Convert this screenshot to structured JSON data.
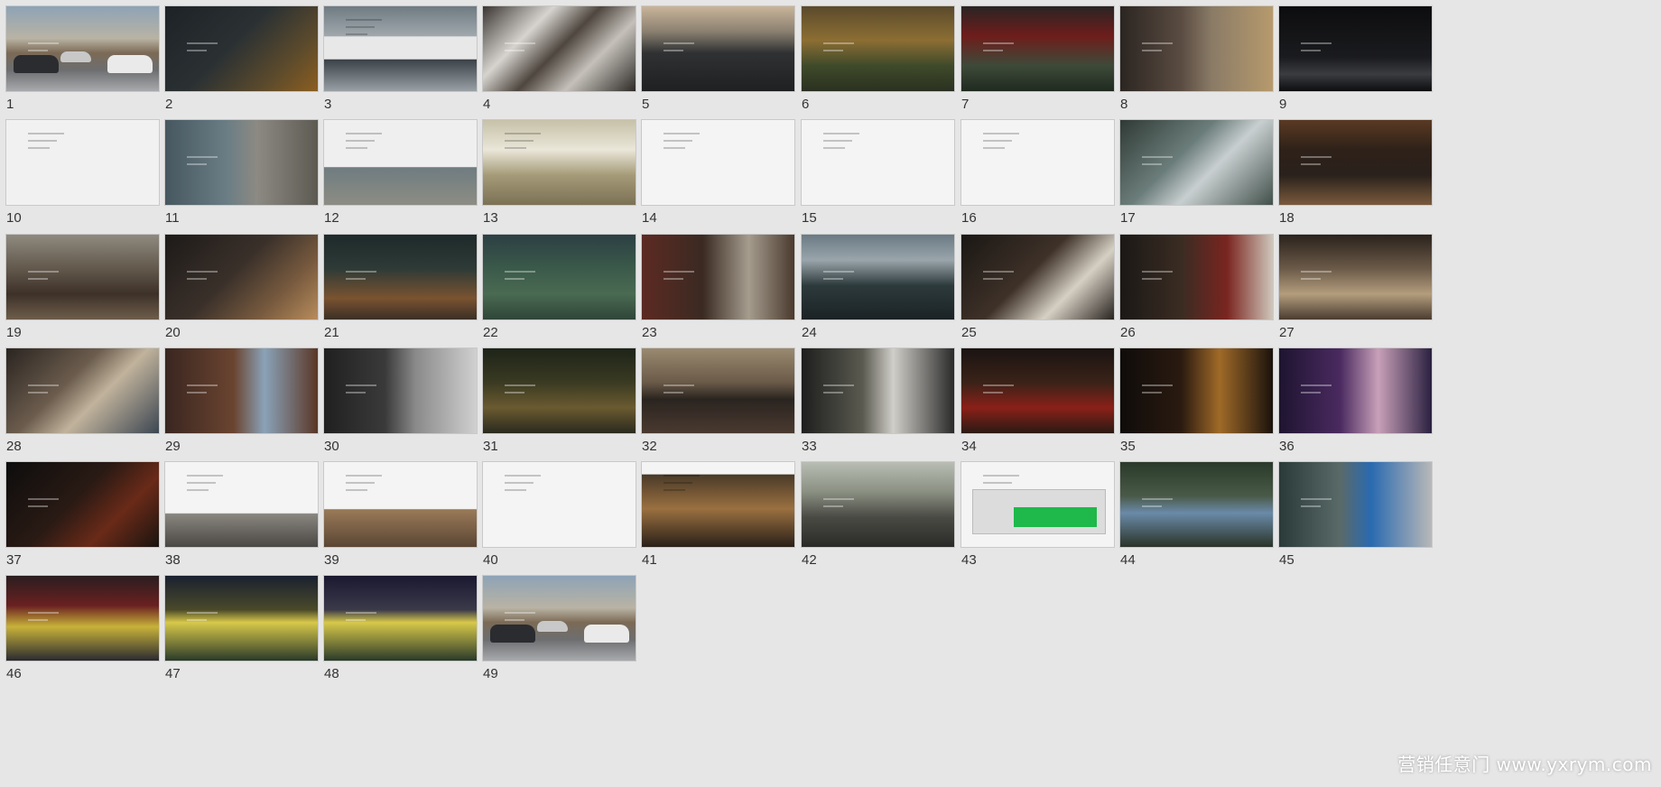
{
  "slides": [
    {
      "label": "1",
      "bg": "linear-gradient(180deg,#8ea3b6 0%,#b9b3a4 38%,#7b6a55 55%,#6d6e70 75%,#a8aaad 100%)",
      "kind": "car"
    },
    {
      "label": "2",
      "bg": "linear-gradient(135deg,#1d2226 0%,#2b3133 45%,#5b4a2c 75%,#8b5e20 100%)",
      "kind": "dark"
    },
    {
      "label": "3",
      "bg": "linear-gradient(180deg,#6f7b82 0%,#a0a8ad 35%,#e8e8e8 36%,#e8e8e8 62%,#3b4248 63%,#9aa1a6 100%)",
      "kind": "light"
    },
    {
      "label": "4",
      "bg": "linear-gradient(135deg,#3a3532 0%,#d7d4cf 30%,#4e463f 50%,#c5c1ba 70%,#2e2a27 100%)",
      "kind": "dark"
    },
    {
      "label": "5",
      "bg": "linear-gradient(180deg,#c9b59a 0%,#8a7f70 30%,#2f3133 55%,#1e2022 100%)",
      "kind": "dark"
    },
    {
      "label": "6",
      "bg": "linear-gradient(180deg,#5a4a2c 0%,#8c6e33 40%,#3f4a2a 70%,#2a3020 100%)",
      "kind": "dark"
    },
    {
      "label": "7",
      "bg": "linear-gradient(180deg,#2a2424 0%,#6e1d1b 35%,#3e4a39 70%,#1f2a1f 100%)",
      "kind": "dark"
    },
    {
      "label": "8",
      "bg": "linear-gradient(90deg,#2b2521 0%,#5a4c42 40%,#8a7b66 60%,#b79a6d 100%)",
      "kind": "dark"
    },
    {
      "label": "9",
      "bg": "linear-gradient(180deg,#0d0d0f 0%,#1a1b1e 60%,#3a3c40 80%,#0d0d0f 100%)",
      "kind": "dark"
    },
    {
      "label": "10",
      "bg": "#f1f1f1",
      "kind": "light"
    },
    {
      "label": "11",
      "bg": "linear-gradient(90deg,#46575f 0%,#6a7d84 40%,#8c8a83 60%,#5d5a52 100%)",
      "kind": "dark"
    },
    {
      "label": "12",
      "bg": "linear-gradient(180deg,#efefef 0%,#efefef 55%,#6f7c80 56%,#8d8d84 100%)",
      "kind": "light"
    },
    {
      "label": "13",
      "bg": "linear-gradient(180deg,#c6c1a7 0%,#eae6d9 35%,#a59b79 65%,#7b7154 100%)",
      "kind": "light"
    },
    {
      "label": "14",
      "bg": "#f4f4f4",
      "kind": "light"
    },
    {
      "label": "15",
      "bg": "#f4f4f4",
      "kind": "light"
    },
    {
      "label": "16",
      "bg": "#f4f4f4",
      "kind": "light"
    },
    {
      "label": "17",
      "bg": "linear-gradient(135deg,#2f3a35 0%,#6b7d7a 40%,#c8cfd0 60%,#41504a 100%)",
      "kind": "dark"
    },
    {
      "label": "18",
      "bg": "linear-gradient(180deg,#5a3a23 0%,#2e2119 35%,#2a211c 65%,#7a5a3c 100%)",
      "kind": "dark"
    },
    {
      "label": "19",
      "bg": "linear-gradient(180deg,#8f8a7f 0%,#5d5246 45%,#3d3128 70%,#6e5d4b 100%)",
      "kind": "dark"
    },
    {
      "label": "20",
      "bg": "linear-gradient(135deg,#1d1a18 0%,#3a302a 45%,#7a5c3f 75%,#b88c5c 100%)",
      "kind": "dark"
    },
    {
      "label": "21",
      "bg": "linear-gradient(180deg,#1e2a2a 0%,#2e3a36 40%,#7a5330 75%,#3a2f25 100%)",
      "kind": "dark"
    },
    {
      "label": "22",
      "bg": "linear-gradient(180deg,#2c3f44 0%,#3b5a4a 40%,#4a6a52 70%,#2f4538 100%)",
      "kind": "dark"
    },
    {
      "label": "23",
      "bg": "linear-gradient(90deg,#5c2a22 0%,#3a2a22 40%,#a59c8e 70%,#4a3a2e 100%)",
      "kind": "dark"
    },
    {
      "label": "24",
      "bg": "linear-gradient(180deg,#6a7a84 0%,#9aa5ab 30%,#2d3a3c 60%,#1b2224 100%)",
      "kind": "dark"
    },
    {
      "label": "25",
      "bg": "linear-gradient(135deg,#1a1714 0%,#3e3128 45%,#d6d0c4 70%,#2a2420 100%)",
      "kind": "dark"
    },
    {
      "label": "26",
      "bg": "linear-gradient(90deg,#1b1816 0%,#3a2c22 40%,#7a2520 70%,#cfc7bb 100%)",
      "kind": "dark"
    },
    {
      "label": "27",
      "bg": "linear-gradient(180deg,#2a221c 0%,#6b5a48 40%,#b39d7d 70%,#4a3c30 100%)",
      "kind": "dark"
    },
    {
      "label": "28",
      "bg": "linear-gradient(135deg,#2a2420 0%,#6b5c4d 40%,#c1b39c 60%,#3c4652 100%)",
      "kind": "dark"
    },
    {
      "label": "29",
      "bg": "linear-gradient(90deg,#3a2620 0%,#6a4430 45%,#8aa3b8 65%,#5a3626 100%)",
      "kind": "dark"
    },
    {
      "label": "30",
      "bg": "linear-gradient(90deg,#202020 0%,#3a3a3a 40%,#8a8a8a 60%,#d0d0d0 100%)",
      "kind": "dark"
    },
    {
      "label": "31",
      "bg": "linear-gradient(180deg,#1e2418 0%,#3a3a22 40%,#6a5a30 70%,#2a2a1e 100%)",
      "kind": "dark"
    },
    {
      "label": "32",
      "bg": "linear-gradient(180deg,#9a8a70 0%,#6a5a48 40%,#2a2420 60%,#4a3a30 100%)",
      "kind": "dark"
    },
    {
      "label": "33",
      "bg": "linear-gradient(90deg,#1e1e1e 0%,#5a5a50 40%,#d0cec8 60%,#2a2a2a 100%)",
      "kind": "dark"
    },
    {
      "label": "34",
      "bg": "linear-gradient(180deg,#1a1412 0%,#3a2218 40%,#8a2018 70%,#2a1a14 100%)",
      "kind": "dark"
    },
    {
      "label": "35",
      "bg": "linear-gradient(90deg,#0f0c0a 0%,#2a1a10 40%,#a06a28 65%,#1a120c 100%)",
      "kind": "dark"
    },
    {
      "label": "36",
      "bg": "linear-gradient(90deg,#1e1430 0%,#4a2a60 40%,#c8a0b8 65%,#2a2040 100%)",
      "kind": "dark"
    },
    {
      "label": "37",
      "bg": "linear-gradient(135deg,#0d0d0d 0%,#2a1a14 45%,#6a2a18 70%,#1a1410 100%)",
      "kind": "dark"
    },
    {
      "label": "38",
      "bg": "linear-gradient(180deg,#f4f4f4 0%,#f4f4f4 60%,#8a8680 61%,#4a4844 100%)",
      "kind": "light"
    },
    {
      "label": "39",
      "bg": "linear-gradient(180deg,#f4f4f4 0%,#f4f4f4 55%,#9a7a58 56%,#5a4634 100%)",
      "kind": "light"
    },
    {
      "label": "40",
      "bg": "#f4f4f4",
      "kind": "light"
    },
    {
      "label": "41",
      "bg": "linear-gradient(180deg,#f4f4f4 0%,#f4f4f4 14%,#4a3a28 15%,#9a7040 55%,#2a2018 100%)",
      "kind": "light"
    },
    {
      "label": "42",
      "bg": "linear-gradient(180deg,#b9bdb4 0%,#8a9082 35%,#4a4a44 65%,#2a2a28 100%)",
      "kind": "dark"
    },
    {
      "label": "43",
      "bg": "#f4f4f4",
      "kind": "plan"
    },
    {
      "label": "44",
      "bg": "linear-gradient(180deg,#2a3a2a 0%,#4a5a48 40%,#6a8aa8 60%,#2a3428 100%)",
      "kind": "dark"
    },
    {
      "label": "45",
      "bg": "linear-gradient(90deg,#2a3a38 0%,#5a6a68 40%,#2a6ab0 60%,#b8b8b8 100%)",
      "kind": "dark"
    },
    {
      "label": "46",
      "bg": "linear-gradient(180deg,#2a1e20 0%,#6a2020 35%,#c8b23a 60%,#2a2a30 100%)",
      "kind": "dark"
    },
    {
      "label": "47",
      "bg": "linear-gradient(180deg,#1a2030 0%,#4a4a2a 40%,#d8c84a 55%,#2a3a2a 100%)",
      "kind": "dark"
    },
    {
      "label": "48",
      "bg": "linear-gradient(180deg,#1a1830 0%,#3a3a4a 40%,#d8c84a 55%,#2a3a2a 100%)",
      "kind": "dark"
    },
    {
      "label": "49",
      "bg": "linear-gradient(180deg,#8ea3b6 0%,#b9b3a4 38%,#7b6a55 55%,#6d6e70 75%,#a8aaad 100%)",
      "kind": "car"
    }
  ],
  "watermark": "营销任意门 www.yxrym.com"
}
